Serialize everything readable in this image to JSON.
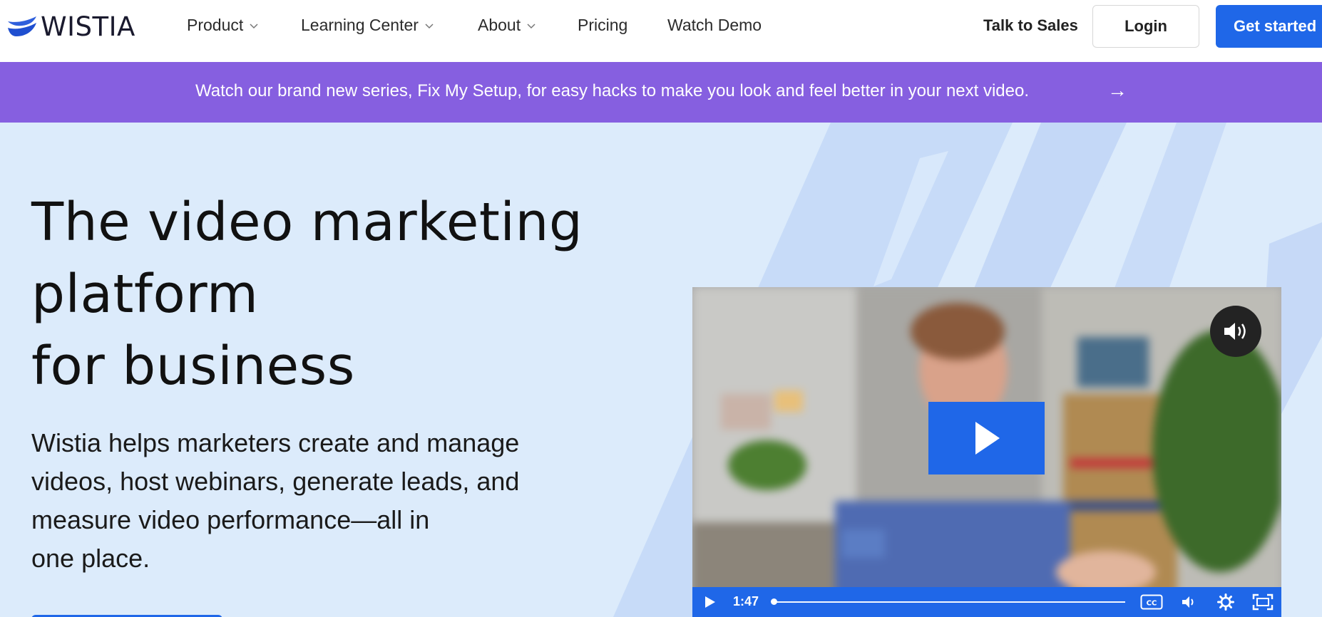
{
  "header": {
    "logo_text": "WISTIA",
    "nav": [
      {
        "label": "Product",
        "has_dropdown": true
      },
      {
        "label": "Learning Center",
        "has_dropdown": true
      },
      {
        "label": "About",
        "has_dropdown": true
      },
      {
        "label": "Pricing",
        "has_dropdown": false
      },
      {
        "label": "Watch Demo",
        "has_dropdown": false
      }
    ],
    "talk_to_sales": "Talk to Sales",
    "login": "Login",
    "get_started": "Get started"
  },
  "banner": {
    "text": "Watch our brand new series, Fix My Setup, for easy hacks to make you look and feel better in your next video.",
    "arrow": "→"
  },
  "hero": {
    "headline_lines": [
      "The video marketing",
      "platform",
      "for business"
    ],
    "subtext_lines": [
      "Wistia helps marketers create and manage",
      "videos, host webinars, generate leads, and",
      "measure video performance—all in",
      "one place."
    ]
  },
  "video": {
    "time": "1:47",
    "progress": 0.0,
    "icons": [
      "volume-icon",
      "play-icon",
      "captions-icon",
      "speaker-icon",
      "settings-icon",
      "fullscreen-icon"
    ]
  },
  "colors": {
    "brand_blue": "#1f67e8",
    "banner_purple": "#865fe0",
    "hero_bg": "#dcebfb",
    "stroke_blue": "#c5d9f7"
  }
}
